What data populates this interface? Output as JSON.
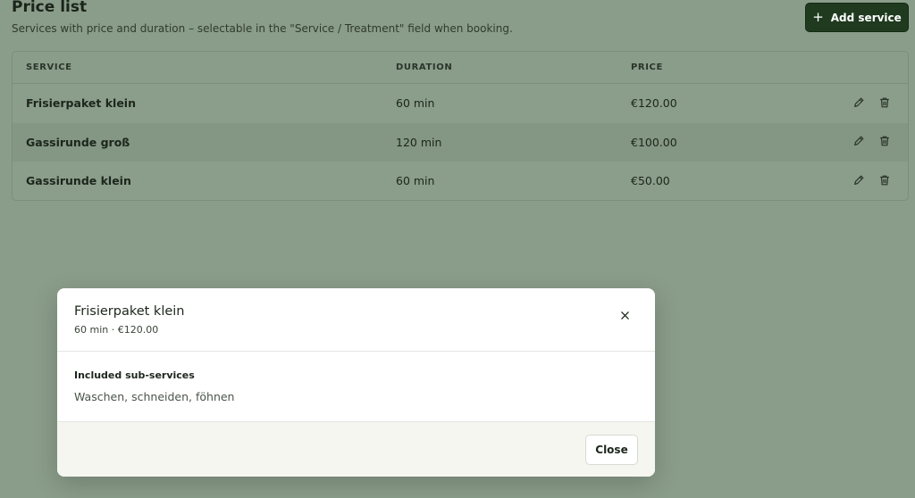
{
  "header": {
    "title": "Price list",
    "subtitle": "Services with price and duration – selectable in the \"Service / Treatment\" field when booking.",
    "add_button_label": "Add service",
    "add_icon": "plus-icon"
  },
  "table": {
    "columns": [
      "SERVICE",
      "DURATION",
      "PRICE"
    ],
    "rows": [
      {
        "service": "Frisierpaket klein",
        "duration": "60 min",
        "price": "€120.00"
      },
      {
        "service": "Gassirunde groß",
        "duration": "120 min",
        "price": "€100.00"
      },
      {
        "service": "Gassirunde klein",
        "duration": "60 min",
        "price": "€50.00"
      }
    ],
    "row_icons": [
      "pencil-icon",
      "trash-icon"
    ]
  },
  "modal": {
    "title": "Frisierpaket klein",
    "meta": "60 min · €120.00",
    "section_label": "Included sub-services",
    "section_text": "Waschen, schneiden, föhnen",
    "close_label": "Close",
    "close_icon": "close-icon"
  },
  "colors": {
    "backdrop": "#8a9c8a",
    "primary_button": "#1f3a1f",
    "modal_footer": "#f6f6f1"
  }
}
